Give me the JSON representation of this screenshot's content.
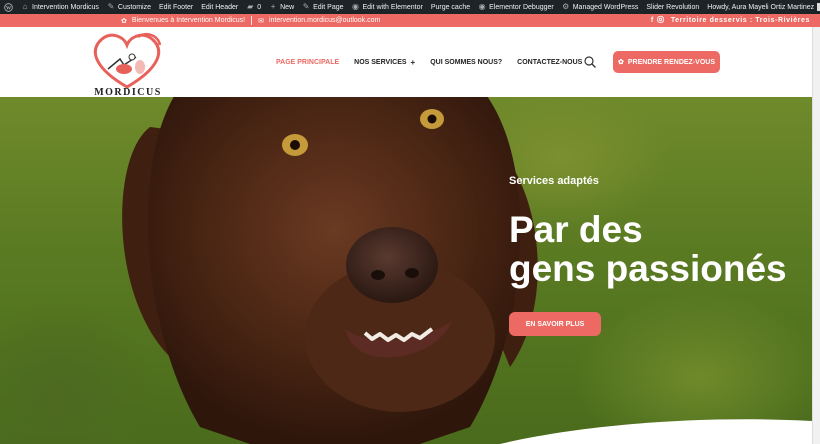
{
  "admin_bar": {
    "site_name": "Intervention Mordicus",
    "customize": "Customize",
    "edit_footer": "Edit Footer",
    "edit_header": "Edit Header",
    "comments_count": "0",
    "new": "New",
    "edit_page": "Edit Page",
    "edit_elementor": "Edit with Elementor",
    "purge_cache": "Purge cache",
    "elementor_debugger": "Elementor Debugger",
    "managed_wordpress": "Managed WordPress",
    "slider_revolution": "Slider Revolution",
    "howdy": "Howdy, Aura Mayeli Ortiz Martinez"
  },
  "top_bar": {
    "welcome": "Bienvenues à Intervention Mordicus!",
    "email": "intervention.mordicus@outlook.com",
    "social_facebook": "f",
    "territory": "Territoire desservis : Trois-Rivières"
  },
  "header": {
    "logo_text": "MORDICUS",
    "nav": [
      {
        "label": "PAGE PRINCIPALE",
        "active": true
      },
      {
        "label": "NOS SERVICES",
        "has_submenu": true
      },
      {
        "label": "QUI SOMMES NOUS?"
      },
      {
        "label": "CONTACTEZ-NOUS"
      }
    ],
    "nav_submenu_indicator": "+",
    "cta_label": "PRENDRE RENDEZ-VOUS"
  },
  "hero": {
    "subtitle": "Services adaptés",
    "heading_line1": "Par des",
    "heading_line2": "gens passionés",
    "button_label": "EN SAVOIR PLUS"
  },
  "colors": {
    "accent": "#ec6a63",
    "admin_bar_bg": "#1d2327"
  }
}
